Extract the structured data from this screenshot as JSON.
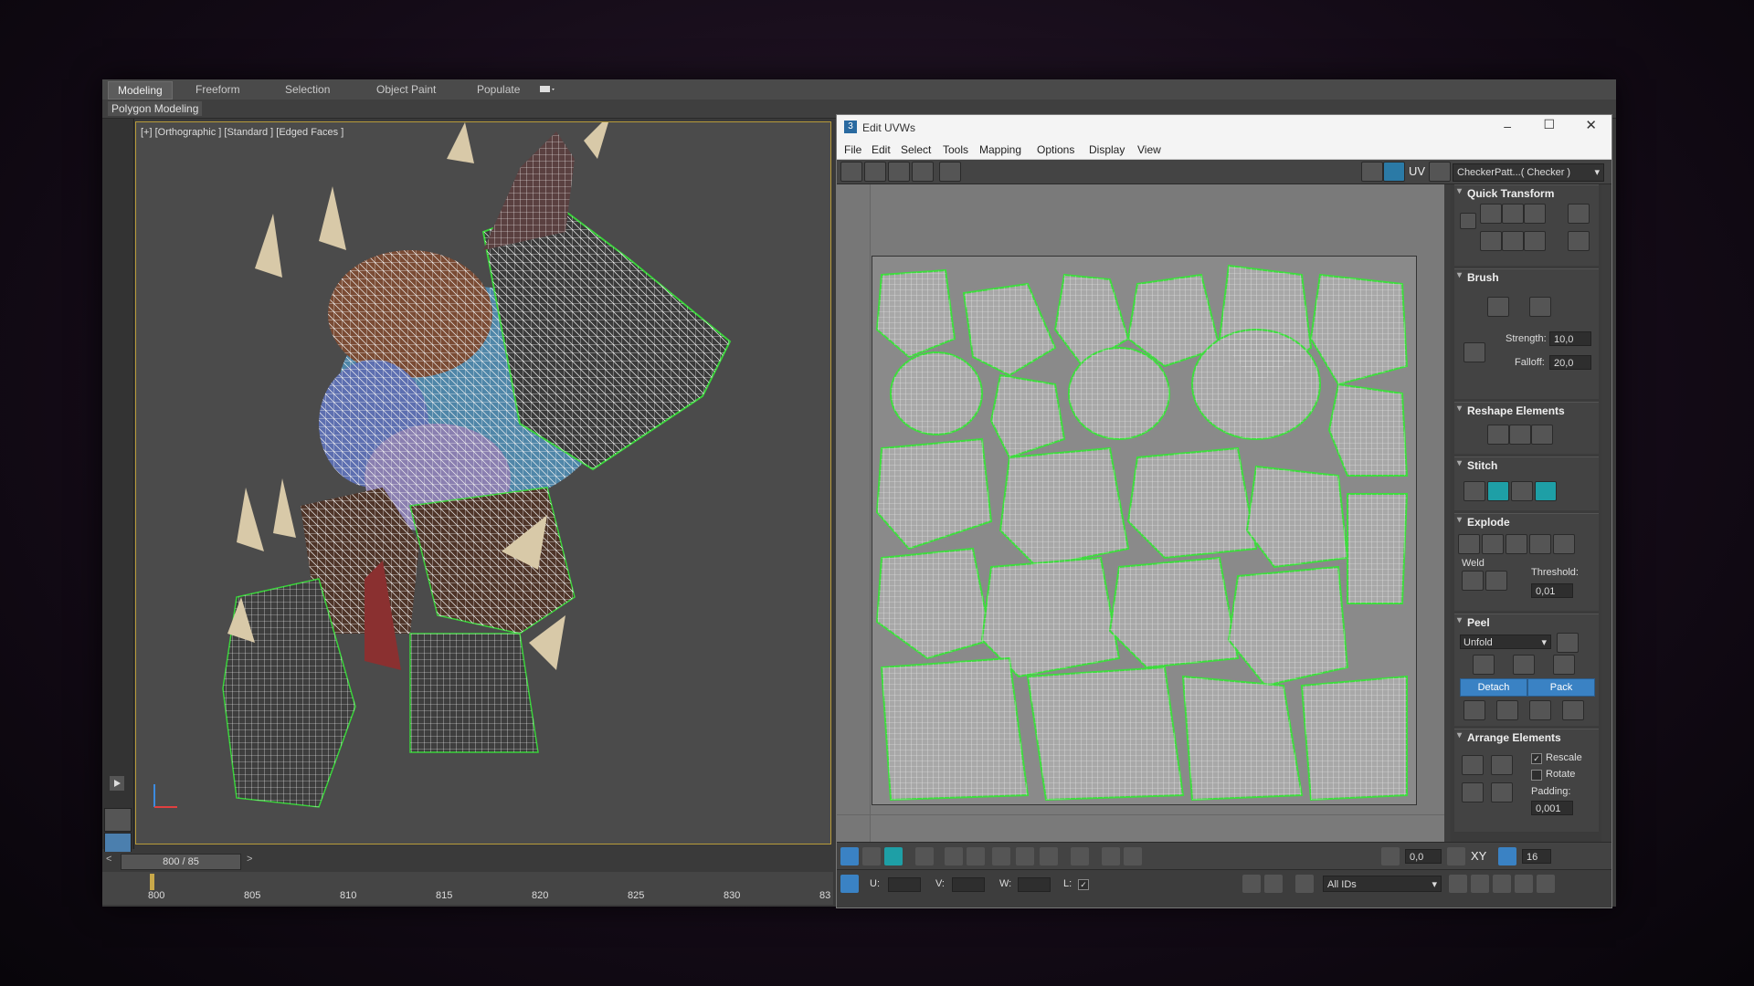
{
  "ribbon": {
    "tabs": [
      "Modeling",
      "Freeform",
      "Selection",
      "Object Paint",
      "Populate"
    ],
    "sub_label": "Polygon Modeling"
  },
  "viewport": {
    "label": "[+] [Orthographic ] [Standard ] [Edged Faces ]"
  },
  "timeline": {
    "slider": "800 / 85",
    "ticks": [
      "800",
      "805",
      "810",
      "815",
      "820",
      "825",
      "830",
      "83"
    ]
  },
  "uvw": {
    "title": "Edit UVWs",
    "menu": [
      "File",
      "Edit",
      "Select",
      "Tools",
      "Mapping",
      "Options",
      "Display",
      "View"
    ],
    "uv_label": "UV",
    "checker": "CheckerPatt...( Checker )",
    "panel": {
      "quick_transform": "Quick Transform",
      "brush": "Brush",
      "strength_label": "Strength:",
      "strength_value": "10,0",
      "falloff_label": "Falloff:",
      "falloff_value": "20,0",
      "reshape": "Reshape Elements",
      "stitch": "Stitch",
      "explode": "Explode",
      "weld": "Weld",
      "threshold_label": "Threshold:",
      "threshold_value": "0,01",
      "peel": "Peel",
      "unfold": "Unfold",
      "detach": "Detach",
      "pack": "Pack",
      "arrange": "Arrange Elements",
      "rescale": "Rescale",
      "rotate": "Rotate",
      "padding_label": "Padding:",
      "padding_value": "0,001"
    },
    "bottom": {
      "angle_value": "0,0",
      "xy": "XY",
      "grid_value": "16",
      "u": "U:",
      "v": "V:",
      "w": "W:",
      "l": "L:",
      "ids": "All IDs"
    }
  }
}
